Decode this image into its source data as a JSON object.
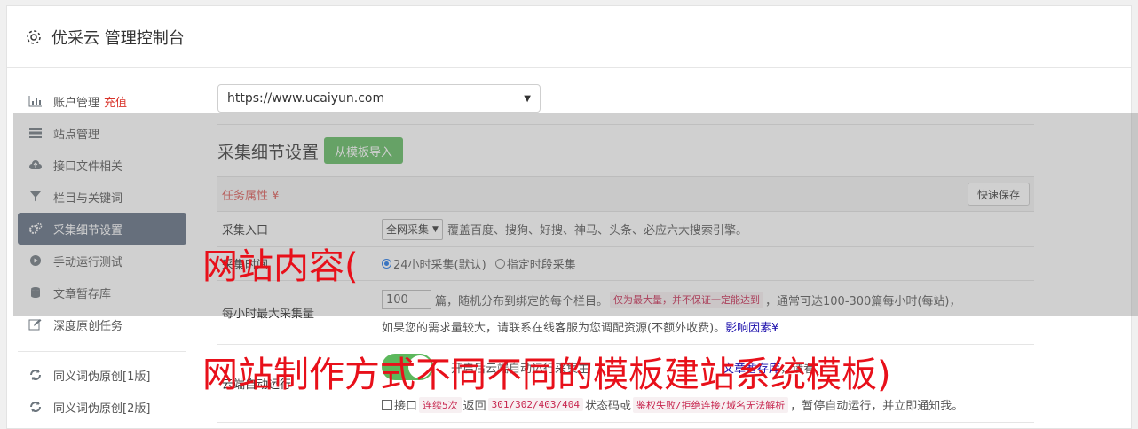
{
  "header": {
    "title": "优采云 管理控制台",
    "icon": "gear-icon"
  },
  "sidebar": {
    "items": [
      {
        "label": "账户管理",
        "accent": "充值",
        "icon": "bar-chart-icon"
      },
      {
        "label": "站点管理",
        "icon": "server-icon"
      },
      {
        "label": "接口文件相关",
        "icon": "cloud-upload-icon"
      },
      {
        "label": "栏目与关键词",
        "icon": "filter-icon"
      },
      {
        "label": "采集细节设置",
        "icon": "cogs-icon",
        "active": true
      },
      {
        "label": "手动运行测试",
        "icon": "play-circle-icon"
      },
      {
        "label": "文章暂存库",
        "icon": "database-icon"
      },
      {
        "label": "深度原创任务",
        "icon": "edit-icon"
      },
      {
        "label": "同义词伪原创[1版]",
        "icon": "refresh-icon"
      },
      {
        "label": "同义词伪原创[2版]",
        "icon": "refresh-icon"
      }
    ]
  },
  "main": {
    "site_select": "https://www.ucaiyun.com",
    "section_title": "采集细节设置",
    "import_button": "从模板导入",
    "task_props": "任务属性",
    "quick_save": "快速保存",
    "rows": {
      "entry": {
        "label": "采集入口",
        "select": "全网采集",
        "desc": "覆盖百度、搜狗、好搜、神马、头条、必应六大搜索引擎。"
      },
      "time": {
        "label": "采集时间",
        "opt1": "24小时采集(默认)",
        "opt2": "指定时段采集"
      },
      "max": {
        "label": "每小时最大采集量",
        "value": "100",
        "t1": "篇，随机分布到绑定的每个栏目。",
        "code1": "仅为最大量，并不保证一定能达到",
        "t2": "，通常可达100-300篇每小时(每站)，",
        "t3": "如果您的需求量较大，请联系在线客服为您调配资源(不额外收费)。",
        "link": "影响因素"
      },
      "cloud": {
        "label": "云端自动运行",
        "l1a": "开启后云端自动运行采集主",
        "l1b": "文章暂存库",
        "l1c": "，请看",
        "c_prefix": "接口",
        "code_a": "连续5次",
        "c_mid1": "返回",
        "code_b": "301/302/403/404",
        "c_mid2": "状态码或",
        "code_c": "鉴权失败/拒绝连接/域名无法解析",
        "c_end": "，暂停自动运行，并立即通知我。"
      }
    }
  },
  "watermark": {
    "line1": "网站内容(",
    "line2": "网站制作方式不同不同的模板建站系统模板)"
  }
}
